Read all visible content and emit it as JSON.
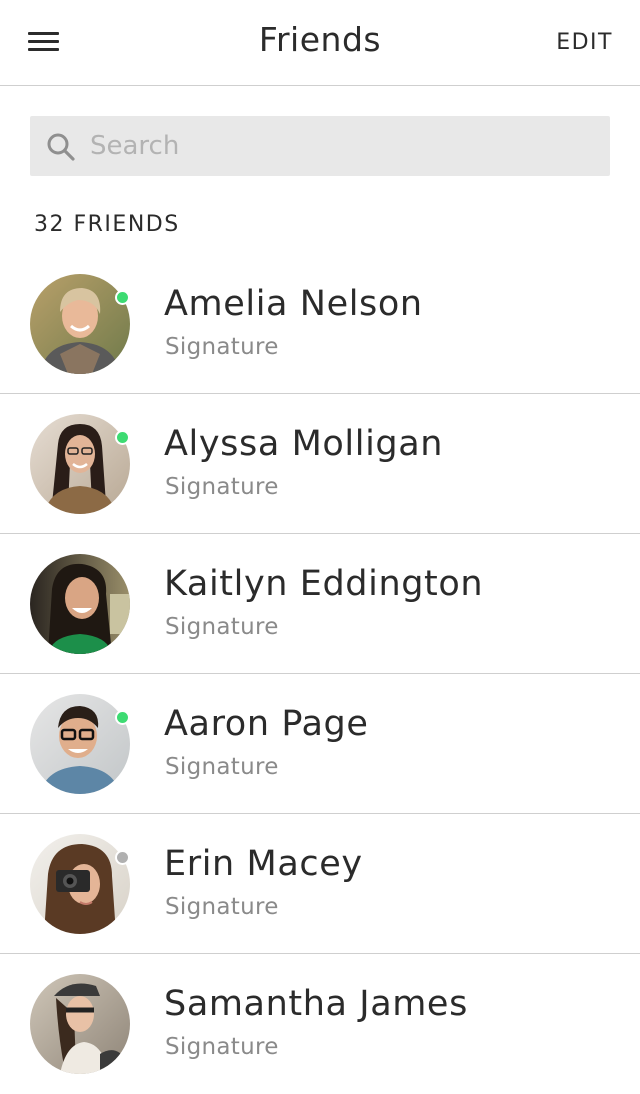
{
  "header": {
    "title": "Friends",
    "edit_label": "EDIT",
    "menu_icon": "hamburger-menu-icon"
  },
  "search": {
    "placeholder": "Search",
    "value": "",
    "icon": "search-icon"
  },
  "friends_count_label": "32 FRIENDS",
  "colors": {
    "online": "#3ddb72",
    "offline": "#b0b0b0",
    "divider": "#cfcfcf",
    "search_bg": "#e8e8e8"
  },
  "friends": [
    {
      "name": "Amelia Nelson",
      "subtitle": "Signature",
      "status": "online"
    },
    {
      "name": "Alyssa Molligan",
      "subtitle": "Signature",
      "status": "online"
    },
    {
      "name": "Kaitlyn Eddington",
      "subtitle": "Signature",
      "status": "none"
    },
    {
      "name": "Aaron Page",
      "subtitle": "Signature",
      "status": "online"
    },
    {
      "name": "Erin Macey",
      "subtitle": "Signature",
      "status": "offline"
    },
    {
      "name": "Samantha James",
      "subtitle": "Signature",
      "status": "none"
    }
  ]
}
